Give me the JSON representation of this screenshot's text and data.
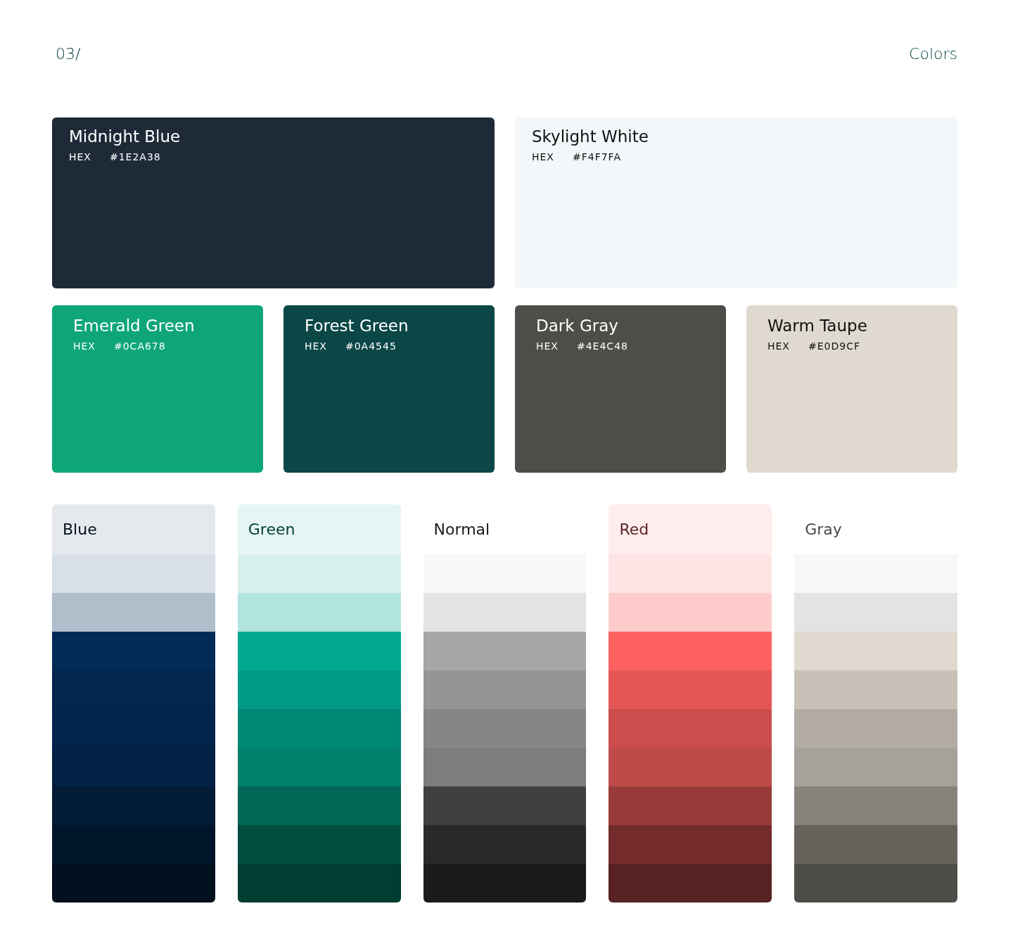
{
  "header": {
    "section": "03/",
    "title": "Colors"
  },
  "main_colors": [
    {
      "name": "Midnight Blue",
      "hex_label": "HEX",
      "hex": "#1E2A38",
      "color": "#1e2a38"
    },
    {
      "name": "Skylight White",
      "hex_label": "HEX",
      "hex": "#F4F7FA",
      "color": "#f3f7fa"
    }
  ],
  "accent_colors": [
    {
      "name": "Emerald Green",
      "hex_label": "HEX",
      "hex": "#0CA678",
      "color": "#0ea678"
    },
    {
      "name": "Forest Green",
      "hex_label": "HEX",
      "hex": "#0A4545",
      "color": "#0a4746"
    },
    {
      "name": "Dark Gray",
      "hex_label": "HEX",
      "hex": "#4E4C48",
      "color": "#4e4d49"
    },
    {
      "name": "Warm Taupe",
      "hex_label": "HEX",
      "hex": "#E0D9CF",
      "color": "#e0d9cf"
    }
  ],
  "ramps": [
    {
      "name": "Blue",
      "color": "#e5e9ee",
      "swatches": [
        {
          "color": "#d9dfe6"
        },
        {
          "color": "#b0becc"
        },
        {
          "color": "#022b57"
        },
        {
          "color": "#02264f"
        },
        {
          "color": "#02244b"
        },
        {
          "color": "#022146"
        },
        {
          "color": "#021b36"
        },
        {
          "color": "#01152a"
        },
        {
          "color": "#010f1e"
        }
      ]
    },
    {
      "name": "Green",
      "color": "#e6f5f3",
      "swatches": [
        {
          "color": "#d8f0ed"
        },
        {
          "color": "#b0e4dc"
        },
        {
          "color": "#00a892"
        },
        {
          "color": "#009a85"
        },
        {
          "color": "#008877"
        },
        {
          "color": "#00806b"
        },
        {
          "color": "#006655"
        },
        {
          "color": "#004d40"
        },
        {
          "color": "#003d33"
        }
      ]
    },
    {
      "name": "Normal",
      "swatches": [
        {
          "color": "#f7f7f7"
        },
        {
          "color": "#e3e3e3"
        },
        {
          "color": "#a6a6a6"
        },
        {
          "color": "#959595"
        },
        {
          "color": "#868686"
        },
        {
          "color": "#7d7d7d"
        },
        {
          "color": "#404040"
        },
        {
          "color": "#292929"
        },
        {
          "color": "#1a1a1a"
        }
      ]
    },
    {
      "name": "Red",
      "color": "#ffedee",
      "swatches": [
        {
          "color": "#ffe4e5"
        },
        {
          "color": "#ffcccc"
        },
        {
          "color": "#ff6161"
        },
        {
          "color": "#e55756"
        },
        {
          "color": "#cc4d4d"
        },
        {
          "color": "#bf4a4a"
        },
        {
          "color": "#993a3a"
        },
        {
          "color": "#732b2b"
        },
        {
          "color": "#592222"
        }
      ]
    },
    {
      "name": "Gray",
      "swatches": [
        {
          "color": "#f7f7f7"
        },
        {
          "color": "#e3e3e3"
        },
        {
          "color": "#e0d9cf"
        },
        {
          "color": "#c9c1b7"
        },
        {
          "color": "#b2aca5"
        },
        {
          "color": "#a6a19a"
        },
        {
          "color": "#87837b"
        },
        {
          "color": "#66625c"
        },
        {
          "color": "#4e4c48"
        }
      ]
    }
  ]
}
